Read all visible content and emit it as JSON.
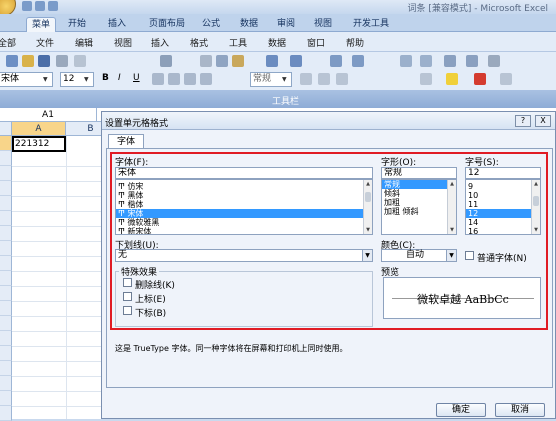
{
  "window": {
    "title": "词条 [兼容模式] - Microsoft Excel"
  },
  "ribbon_tabs": [
    {
      "label": "菜单"
    },
    {
      "label": "开始"
    },
    {
      "label": "插入"
    },
    {
      "label": "页面布局"
    },
    {
      "label": "公式"
    },
    {
      "label": "数据"
    },
    {
      "label": "审阅"
    },
    {
      "label": "视图"
    },
    {
      "label": "开发工具"
    }
  ],
  "menu": [
    "全部",
    "文件",
    "编辑",
    "视图",
    "插入",
    "格式",
    "工具",
    "数据",
    "窗口",
    "帮助"
  ],
  "toolbar": {
    "font_name": "宋体",
    "font_size": "12",
    "number_format": "常规",
    "group_label": "工具栏",
    "bold": "B",
    "italic": "I",
    "underline": "U"
  },
  "formula_bar": {
    "name_box": "A1"
  },
  "sheet": {
    "columns": [
      "A",
      "B"
    ],
    "cell_a1": "221312"
  },
  "dialog": {
    "title": "设置单元格格式",
    "help": "?",
    "close": "X",
    "tab": "字体",
    "font_label": "字体(F):",
    "font_value": "宋体",
    "font_list": [
      "仿宋",
      "黑体",
      "楷体",
      "宋体",
      "微软雅黑",
      "新宋体"
    ],
    "font_selected_index": 3,
    "style_label": "字形(O):",
    "style_value": "常规",
    "style_list": [
      "常规",
      "倾斜",
      "加粗",
      "加粗 倾斜"
    ],
    "style_selected_index": 0,
    "size_label": "字号(S):",
    "size_value": "12",
    "size_list": [
      "9",
      "10",
      "11",
      "12",
      "14",
      "16"
    ],
    "size_selected_index": 3,
    "underline_label": "下划线(U):",
    "underline_value": "无",
    "color_label": "颜色(C):",
    "color_value": "自动",
    "normal_font_label": "普通字体(N)",
    "effects_label": "特殊效果",
    "effects": [
      "删除线(K)",
      "上标(E)",
      "下标(B)"
    ],
    "preview_label": "预览",
    "preview_text": "微软卓越  AaBbCc",
    "info_text": "这是 TrueType 字体。同一种字体将在屏幕和打印机上同时使用。",
    "ok": "确定",
    "cancel": "取消"
  }
}
